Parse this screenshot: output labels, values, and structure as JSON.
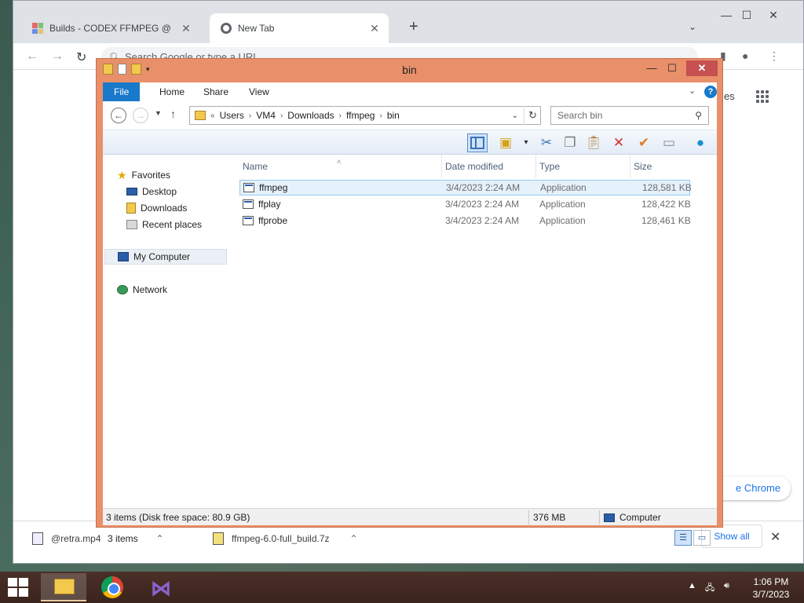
{
  "chrome": {
    "tabs": [
      {
        "title": "Builds - CODEX FFMPEG @ gyan.dev",
        "close": "✕"
      },
      {
        "title": "New Tab",
        "close": "✕"
      }
    ],
    "new_tab": "+",
    "window_controls": {
      "minimize": "—",
      "maximize": "☐",
      "close": "✕"
    },
    "tab_search": "⌄",
    "omnibox_placeholder": "Search Google or type a URL",
    "nav": {
      "back": "←",
      "forward": "→",
      "reload": "↻"
    },
    "ntp_apps_partial": "es",
    "customize_label": "e Chrome",
    "downloads": [
      {
        "name": "@retra.mp4"
      },
      {
        "name": "ffmpeg-6.0-full_build.7z"
      }
    ],
    "show_all": "Show all",
    "dl_close": "✕"
  },
  "explorer": {
    "title": "bin",
    "ribbon_tabs": [
      "File",
      "Home",
      "Share",
      "View"
    ],
    "help": "?",
    "breadcrumb": [
      "Users",
      "VM4",
      "Downloads",
      "ffmpeg",
      "bin"
    ],
    "breadcrumb_prefix": "«",
    "search_placeholder": "Search bin",
    "nav_pane": {
      "favorites": "Favorites",
      "desktop": "Desktop",
      "downloads": "Downloads",
      "recent": "Recent places",
      "computer": "My Computer",
      "network": "Network"
    },
    "columns": [
      "Name",
      "Date modified",
      "Type",
      "Size"
    ],
    "files": [
      {
        "name": "ffmpeg",
        "date": "3/4/2023 2:24 AM",
        "type": "Application",
        "size": "128,581 KB",
        "selected": true
      },
      {
        "name": "ffplay",
        "date": "3/4/2023 2:24 AM",
        "type": "Application",
        "size": "128,422 KB",
        "selected": false
      },
      {
        "name": "ffprobe",
        "date": "3/4/2023 2:24 AM",
        "type": "Application",
        "size": "128,461 KB",
        "selected": false
      }
    ],
    "item_count": "3 items",
    "statusbar": {
      "summary": "3 items (Disk free space: 80.9 GB)",
      "size": "376 MB",
      "location": "Computer"
    }
  },
  "taskbar": {
    "time": "1:06 PM",
    "date": "3/7/2023",
    "vs_glyph": "⋈"
  },
  "colors": {
    "explorer_frame": "#e9906a",
    "ribbon_file": "#1979ca",
    "close_button": "#c75050",
    "taskbar": "#3a241c"
  }
}
